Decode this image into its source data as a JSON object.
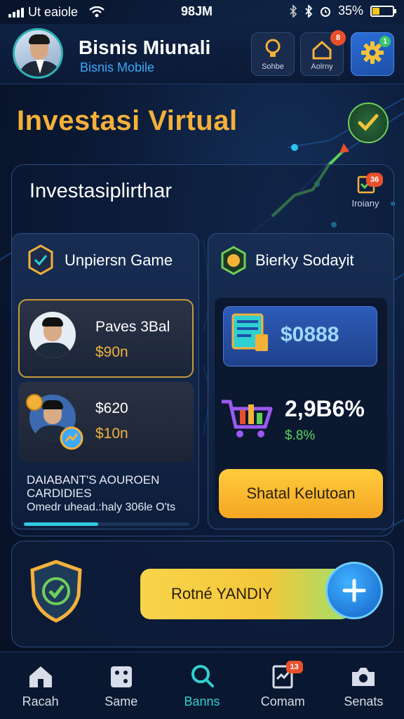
{
  "status_bar": {
    "carrier": "Ut eaiole",
    "time": "98JM",
    "battery": "35%",
    "battery_level": 0.35
  },
  "header": {
    "title": "Bisnis Miunali",
    "subtitle": "Bisnis Mobile",
    "buttons": [
      {
        "label": "Sohbe",
        "icon": "lightbulb-icon"
      },
      {
        "label": "Aolrny",
        "icon": "home-icon",
        "badge": "8"
      },
      {
        "icon": "gear-icon",
        "badge": "1"
      }
    ]
  },
  "hero": {
    "title": "Investasi Virtual",
    "icon": "check-pen-icon"
  },
  "panel": {
    "title": "Investasiplirthar",
    "history": {
      "label": "Iroiany",
      "badge": "36",
      "icon": "checklist-icon"
    }
  },
  "left_card": {
    "title": "Unpiersn Game",
    "items": [
      {
        "name": "Paves 3Bal",
        "price": "$90n"
      },
      {
        "name": "$620",
        "price": "$10n"
      }
    ],
    "note_title": "DAIABANT'S AOUROEN CARDIDIES",
    "note_desc": "Omedr uhead.:haly 306le O'ts",
    "progress": 0.45
  },
  "right_card": {
    "title": "Bierky Sodayit",
    "balance": "$0888",
    "percent": "2,9B6%",
    "percent_sub": "$.8%",
    "button": "Shatal Kelutoan"
  },
  "bottom": {
    "button": "Rotné YANDIY"
  },
  "nav": {
    "items": [
      {
        "label": "Racah",
        "icon": "home-icon"
      },
      {
        "label": "Same",
        "icon": "game-icon"
      },
      {
        "label": "Banns",
        "icon": "search-icon",
        "active": true
      },
      {
        "label": "Comam",
        "icon": "clipboard-icon",
        "badge": "13"
      },
      {
        "label": "Senats",
        "icon": "camera-icon"
      }
    ]
  },
  "colors": {
    "accent_gold": "#f4b13a",
    "accent_teal": "#2fd0d0",
    "accent_blue": "#3fa9ff",
    "positive_green": "#59d65d"
  }
}
